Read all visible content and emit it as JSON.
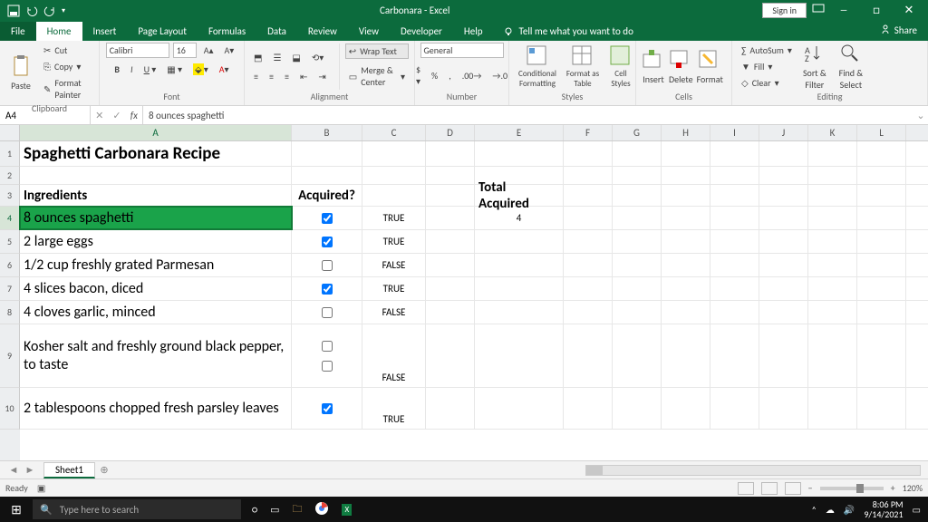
{
  "titlebar": {
    "doc_title": "Carbonara - Excel",
    "signin": "Sign in"
  },
  "tabs": {
    "file": "File",
    "home": "Home",
    "insert": "Insert",
    "page_layout": "Page Layout",
    "formulas": "Formulas",
    "data": "Data",
    "review": "Review",
    "view": "View",
    "developer": "Developer",
    "help": "Help",
    "tellme": "Tell me what you want to do",
    "share": "Share"
  },
  "ribbon": {
    "clipboard": {
      "paste": "Paste",
      "cut": "Cut",
      "copy": "Copy",
      "format_painter": "Format Painter",
      "label": "Clipboard"
    },
    "font": {
      "name": "Calibri",
      "size": "16",
      "label": "Font"
    },
    "align": {
      "wrap": "Wrap Text",
      "merge": "Merge & Center",
      "label": "Alignment"
    },
    "number": {
      "format": "General",
      "label": "Number"
    },
    "styles": {
      "conditional": "Conditional Formatting",
      "table": "Format as Table",
      "cell": "Cell Styles",
      "label": "Styles"
    },
    "cells": {
      "insert": "Insert",
      "delete": "Delete",
      "format": "Format",
      "label": "Cells"
    },
    "editing": {
      "autosum": "AutoSum",
      "fill": "Fill",
      "clear": "Clear",
      "sort": "Sort & Filter",
      "find": "Find & Select",
      "label": "Editing"
    }
  },
  "namebox": "A4",
  "formula": "8 ounces spaghetti",
  "columns": [
    "A",
    "B",
    "C",
    "D",
    "E",
    "F",
    "G",
    "H",
    "I",
    "J",
    "K",
    "L"
  ],
  "rows": {
    "1": {
      "A": "Spaghetti Carbonara Recipe"
    },
    "3": {
      "A": "Ingredients",
      "B": "Acquired?",
      "E": "Total Acquired"
    },
    "4": {
      "A": "8 ounces spaghetti",
      "B_checked": true,
      "C": "TRUE",
      "E": "4"
    },
    "5": {
      "A": "2 large eggs",
      "B_checked": true,
      "C": "TRUE"
    },
    "6": {
      "A": "1/2 cup freshly grated Parmesan",
      "B_checked": false,
      "C": "FALSE"
    },
    "7": {
      "A": "4 slices bacon, diced",
      "B_checked": true,
      "C": "TRUE"
    },
    "8": {
      "A": "4 cloves garlic, minced",
      "B_checked": false,
      "C": "FALSE"
    },
    "9": {
      "A": "Kosher salt and freshly ground black pepper, to taste",
      "B_checked": false,
      "C": "FALSE"
    },
    "10": {
      "A": "2 tablespoons chopped fresh parsley leaves",
      "B_checked": true,
      "C": "TRUE"
    }
  },
  "sheet": {
    "name": "Sheet1"
  },
  "statusbar": {
    "ready": "Ready",
    "zoom": "120%"
  },
  "taskbar": {
    "search_placeholder": "Type here to search",
    "time": "8:06 PM",
    "date": "9/14/2021"
  }
}
